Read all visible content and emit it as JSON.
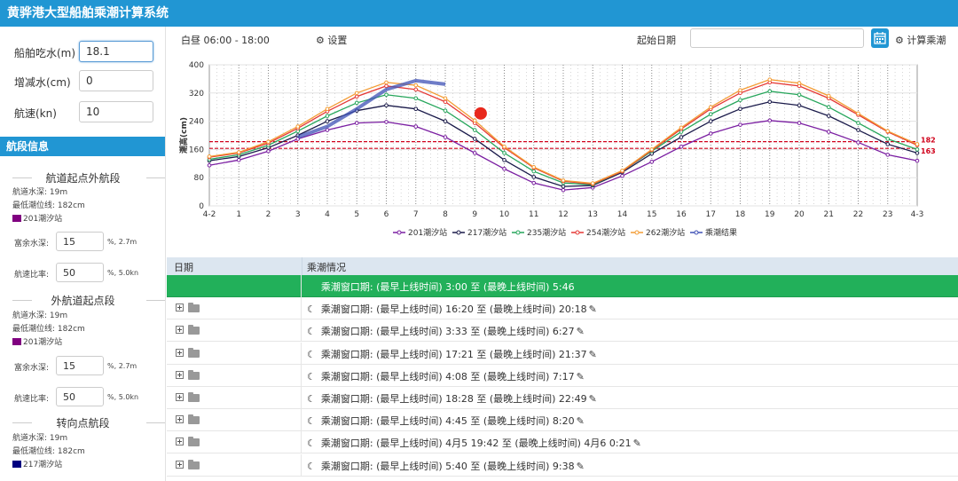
{
  "app": {
    "title": "黄骅港大型船舶乘潮计算系统"
  },
  "params": {
    "draft": {
      "label": "船舶吃水(m)",
      "value": "18.1"
    },
    "water_adjust": {
      "label": "增减水(cm)",
      "value": "0"
    },
    "speed": {
      "label": "航速(kn)",
      "value": "10"
    }
  },
  "sidebar": {
    "section_title": "航段信息",
    "segments": [
      {
        "title": "航道起点外航段",
        "depth": "航道水深:  19m",
        "low_tide": "最低潮位线:  182cm",
        "station": "201潮汐站",
        "station_color": "#800080",
        "margin_label": "富余水深:",
        "margin_value": "15",
        "margin_suffix": "%,  2.7m",
        "ratio_label": "航速比率:",
        "ratio_value": "50",
        "ratio_suffix": "%,  5.0kn"
      },
      {
        "title": "外航道起点段",
        "depth": "航道水深:  19m",
        "low_tide": "最低潮位线:  182cm",
        "station": "201潮汐站",
        "station_color": "#800080",
        "margin_label": "富余水深:",
        "margin_value": "15",
        "margin_suffix": "%,  2.7m",
        "ratio_label": "航速比率:",
        "ratio_value": "50",
        "ratio_suffix": "%,  5.0kn"
      },
      {
        "title": "转向点航段",
        "depth": "航道水深:  19m",
        "low_tide": "最低潮位线:  182cm",
        "station": "217潮汐站",
        "station_color": "#000080"
      }
    ]
  },
  "toolbar": {
    "period": "白昼 06:00 - 18:00",
    "settings": "设置",
    "start_date_label": "起始日期",
    "start_date_value": "",
    "calc": "计算乘潮"
  },
  "chart_data": {
    "type": "line",
    "ylabel": "潮高(cm)",
    "ylim": [
      0,
      400
    ],
    "yticks": [
      0,
      80,
      160,
      240,
      320,
      400
    ],
    "x_labels": [
      "4-2",
      "1",
      "2",
      "3",
      "4",
      "5",
      "6",
      "7",
      "8",
      "9",
      "10",
      "11",
      "12",
      "13",
      "14",
      "15",
      "16",
      "17",
      "18",
      "19",
      "20",
      "21",
      "22",
      "23",
      "4-3"
    ],
    "thresholds": [
      {
        "value": 182,
        "label": "182",
        "color": "#d0021b"
      },
      {
        "value": 163,
        "label": "163",
        "color": "#d0021b"
      }
    ],
    "series": [
      {
        "name": "201潮汐站",
        "color": "#7b1fa2",
        "values": [
          115,
          130,
          155,
          190,
          215,
          235,
          238,
          225,
          195,
          150,
          105,
          65,
          45,
          52,
          85,
          125,
          168,
          205,
          230,
          242,
          235,
          210,
          180,
          145,
          128
        ]
      },
      {
        "name": "217潮汐站",
        "color": "#1a1a4a",
        "values": [
          128,
          140,
          165,
          200,
          240,
          270,
          285,
          275,
          240,
          190,
          130,
          82,
          55,
          58,
          95,
          148,
          195,
          240,
          275,
          295,
          285,
          255,
          215,
          175,
          150
        ]
      },
      {
        "name": "235潮汐站",
        "color": "#26a65b",
        "values": [
          132,
          145,
          172,
          212,
          255,
          292,
          315,
          305,
          270,
          215,
          150,
          98,
          65,
          60,
          98,
          155,
          210,
          260,
          300,
          325,
          315,
          280,
          235,
          190,
          160
        ]
      },
      {
        "name": "254潮汐站",
        "color": "#e53935",
        "values": [
          138,
          150,
          178,
          220,
          268,
          310,
          340,
          330,
          295,
          235,
          165,
          108,
          70,
          62,
          98,
          158,
          218,
          275,
          320,
          350,
          340,
          305,
          258,
          210,
          172
        ]
      },
      {
        "name": "262潮汐站",
        "color": "#f39c34",
        "values": [
          140,
          152,
          182,
          225,
          275,
          320,
          350,
          342,
          305,
          242,
          168,
          110,
          72,
          64,
          100,
          160,
          222,
          280,
          328,
          358,
          348,
          312,
          262,
          212,
          175
        ]
      }
    ],
    "result_series": {
      "name": "乘潮结果",
      "color": "#3f51b5",
      "x": [
        3,
        4,
        5,
        6,
        7,
        8
      ],
      "values": [
        195,
        225,
        275,
        330,
        355,
        345
      ]
    },
    "marker": {
      "x": 9.2,
      "y": 262,
      "color": "#e8281c"
    }
  },
  "table": {
    "headers": [
      "日期",
      "乘潮情况"
    ],
    "rows": [
      {
        "text": "乘潮窗口期:  (最早上线时间) 3:00 至  (最晚上线时间) 5:46"
      },
      {
        "text": "乘潮窗口期:  (最早上线时间) 16:20 至  (最晚上线时间) 20:18"
      },
      {
        "text": "乘潮窗口期:  (最早上线时间) 3:33 至  (最晚上线时间) 6:27"
      },
      {
        "text": "乘潮窗口期:  (最早上线时间) 17:21 至  (最晚上线时间) 21:37"
      },
      {
        "text": "乘潮窗口期:  (最早上线时间) 4:08 至  (最晚上线时间) 7:17"
      },
      {
        "text": "乘潮窗口期:  (最早上线时间) 18:28 至  (最晚上线时间) 22:49"
      },
      {
        "text": "乘潮窗口期:  (最早上线时间) 4:45 至  (最晚上线时间) 8:20"
      },
      {
        "text": "乘潮窗口期:  (最早上线时间) 4月5 19:42 至  (最晚上线时间) 4月6 0:21"
      },
      {
        "text": "乘潮窗口期:  (最早上线时间) 5:40 至  (最晚上线时间) 9:38"
      }
    ]
  }
}
